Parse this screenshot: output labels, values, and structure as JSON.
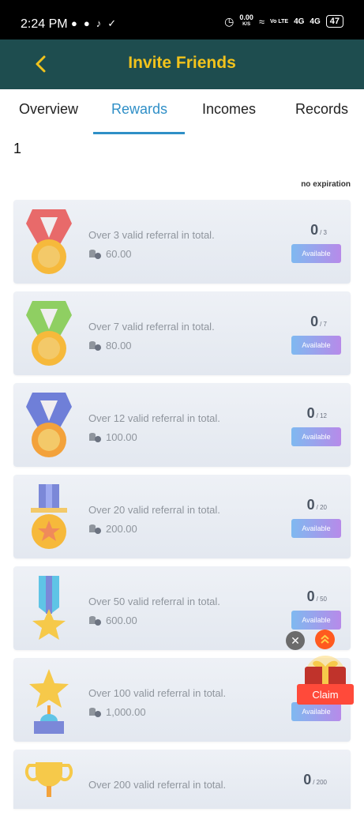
{
  "status_bar": {
    "time": "2:24 PM",
    "net_speed_value": "0.00",
    "net_speed_unit": "K/S",
    "volte": "Vo LTE",
    "sig1": "4G",
    "sig2": "4G",
    "battery": "47"
  },
  "header": {
    "title": "Invite Friends"
  },
  "tabs": [
    {
      "label": "Overview"
    },
    {
      "label": "Rewards"
    },
    {
      "label": "Incomes"
    },
    {
      "label": "Records"
    }
  ],
  "active_tab": "Rewards",
  "page_index": "1",
  "expiry_note": "no expiration",
  "colors": {
    "header_bg": "#1e4d4f",
    "title": "#f2c31c",
    "accent": "#2f8fc7"
  },
  "rewards": [
    {
      "desc": "Over 3 valid referral in total.",
      "amount": "60.00",
      "progress": "0",
      "total": "/ 3",
      "button": "Available",
      "icon": "red-ribbon-medal-icon"
    },
    {
      "desc": "Over 7 valid referral in total.",
      "amount": "80.00",
      "progress": "0",
      "total": "/ 7",
      "button": "Available",
      "icon": "green-ribbon-medal-icon"
    },
    {
      "desc": "Over 12 valid referral in total.",
      "amount": "100.00",
      "progress": "0",
      "total": "/ 12",
      "button": "Available",
      "icon": "blue-ribbon-medal-icon"
    },
    {
      "desc": "Over 20 valid referral in total.",
      "amount": "200.00",
      "progress": "0",
      "total": "/ 20",
      "button": "Available",
      "icon": "star-medal-icon"
    },
    {
      "desc": "Over 50 valid referral in total.",
      "amount": "600.00",
      "progress": "0",
      "total": "/ 50",
      "button": "Available",
      "icon": "star-ribbon-icon"
    },
    {
      "desc": "Over 100 valid referral in total.",
      "amount": "1,000.00",
      "progress": "",
      "total": "",
      "button": "Available",
      "icon": "star-trophy-icon"
    },
    {
      "desc": "Over 200 valid referral in total.",
      "amount": "",
      "progress": "0",
      "total": "/ 200",
      "button": "",
      "icon": "gold-cup-icon"
    }
  ],
  "floating": {
    "claim_label": "Claim"
  }
}
